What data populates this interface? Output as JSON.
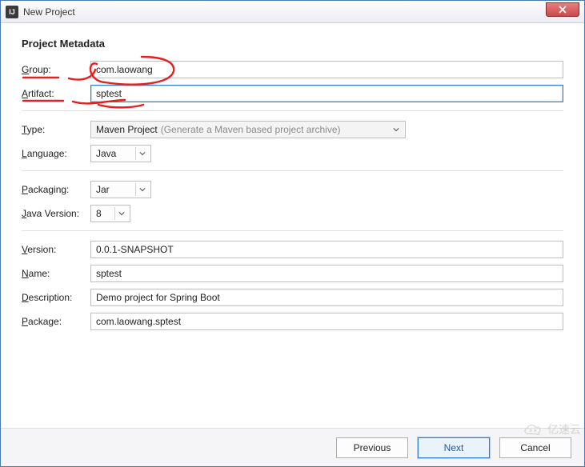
{
  "window": {
    "title": "New Project"
  },
  "section_title": "Project Metadata",
  "labels": {
    "group": "roup:",
    "artifact": "rtifact:",
    "type": "ype:",
    "language": "anguage:",
    "packaging": "ackaging:",
    "java_version": "ava Version:",
    "version": "ersion:",
    "name": "ame:",
    "description": "escription:",
    "package": "ackage:"
  },
  "label_first": {
    "group": "G",
    "artifact": "A",
    "type": "T",
    "language": "L",
    "packaging": "P",
    "java_version": "J",
    "version": "V",
    "name": "N",
    "description": "D",
    "package": "P"
  },
  "values": {
    "group": "com.laowang",
    "artifact": "sptest",
    "type": "Maven Project",
    "type_hint": "(Generate a Maven based project archive)",
    "language": "Java",
    "packaging": "Jar",
    "java_version": "8",
    "version": "0.0.1-SNAPSHOT",
    "name": "sptest",
    "description": "Demo project for Spring Boot",
    "package": "com.laowang.sptest"
  },
  "buttons": {
    "previous": "Previous",
    "next": "Next",
    "cancel": "Cancel"
  },
  "watermark": "亿速云"
}
